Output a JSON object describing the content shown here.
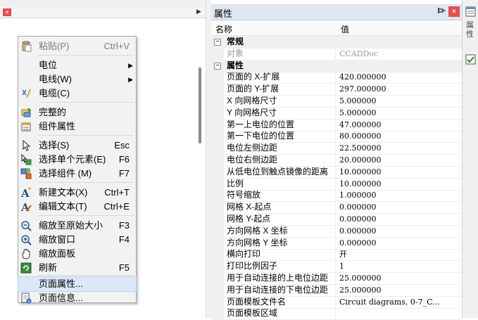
{
  "tab": {
    "close_icon": "close-icon",
    "scroll_arrow": "▶"
  },
  "menu": {
    "items": [
      {
        "label": "粘贴(P)",
        "shortcut": "Ctrl+V",
        "icon": "paste-icon",
        "disabled": true
      },
      {
        "label": "电位",
        "submenu": true
      },
      {
        "label": "电线(W)",
        "submenu": true
      },
      {
        "label": "电缆(C)",
        "icon": "cable-icon"
      },
      {
        "label": "完整的",
        "icon": "complete-icon"
      },
      {
        "label": "组件属性",
        "icon": "component-properties-icon"
      },
      {
        "label": "选择(S)",
        "shortcut": "Esc",
        "icon": "cursor-icon"
      },
      {
        "label": "选择单个元素(E)",
        "shortcut": "F6",
        "icon": "select-element-icon"
      },
      {
        "label": "选择组件 (M)",
        "shortcut": "F7",
        "icon": "select-component-icon"
      },
      {
        "label": "新建文本(X)",
        "shortcut": "Ctrl+T",
        "icon": "new-text-icon"
      },
      {
        "label": "编辑文本(T)",
        "shortcut": "Ctrl+E",
        "icon": "edit-text-icon"
      },
      {
        "label": "缩放至原始大小",
        "shortcut": "F3",
        "icon": "zoom-original-icon"
      },
      {
        "label": "缩放窗口",
        "shortcut": "F4",
        "icon": "zoom-window-icon"
      },
      {
        "label": "缩放面板",
        "icon": "pan-hand-icon"
      },
      {
        "label": "刷新",
        "shortcut": "F5",
        "icon": "refresh-icon"
      },
      {
        "label": "页面属性..."
      },
      {
        "label": "页面信息...",
        "icon": "page-info-icon"
      }
    ]
  },
  "panel": {
    "title": "属性",
    "pin_icon": "pin-icon",
    "close_icon": "close-icon",
    "col_name": "名称",
    "col_value": "值",
    "rows": [
      {
        "type": "cat",
        "name": "常规",
        "toggle": "−"
      },
      {
        "name": "对象",
        "value": "CCADDoc",
        "disabled": true
      },
      {
        "type": "cat",
        "name": "属性",
        "toggle": "−"
      },
      {
        "name": "页面的 X-扩展",
        "value": "420.000000"
      },
      {
        "name": "页面的 Y-扩展",
        "value": "297.000000"
      },
      {
        "name": "X 向网格尺寸",
        "value": "5.000000"
      },
      {
        "name": "Y 向网格尺寸",
        "value": "5.000000"
      },
      {
        "name": "第一上电位的位置",
        "value": "47.000000"
      },
      {
        "name": "第一下电位的位置",
        "value": "80.000000"
      },
      {
        "name": "电位左侧边距",
        "value": "22.500000"
      },
      {
        "name": "电位右侧边距",
        "value": "20.000000"
      },
      {
        "name": "从低电位到触点镜像的距离",
        "value": "10.000000"
      },
      {
        "name": "比例",
        "value": "10.000000"
      },
      {
        "name": "符号缩放",
        "value": "1.000000"
      },
      {
        "name": "网格 X-起点",
        "value": "0.000000"
      },
      {
        "name": "网格 Y-起点",
        "value": "0.000000"
      },
      {
        "name": "方向网格 X 坐标",
        "value": "0.000000"
      },
      {
        "name": "方向网格 Y 坐标",
        "value": "0.000000"
      },
      {
        "name": "横向打印",
        "value": "开"
      },
      {
        "name": "打印比例因子",
        "value": "1"
      },
      {
        "name": "用于自动连接的上电位边距",
        "value": "25.000000"
      },
      {
        "name": "用于自动连接的下电位边距",
        "value": "25.000000"
      },
      {
        "name": "页面模板文件名",
        "value": "Circuit diagrams, 0-7_C..."
      },
      {
        "name": "页面模板区域",
        "value": ""
      }
    ]
  },
  "sidebar": {
    "label": "属性"
  },
  "colors": {
    "accent": "#dbe8f8",
    "panel_title": "#dee6ef",
    "close_red": "#e05252"
  }
}
